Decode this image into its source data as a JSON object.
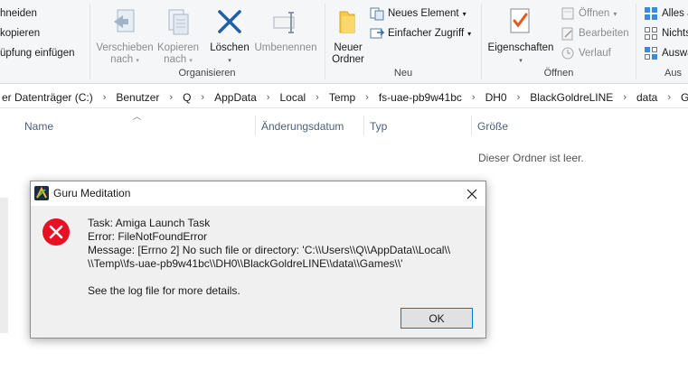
{
  "ribbon": {
    "clipboard": {
      "items": [
        "hneiden",
        "kopieren",
        "üpfung einfügen"
      ]
    },
    "organize": {
      "label": "Organisieren",
      "move_to": {
        "line1": "Verschieben",
        "line2": "nach"
      },
      "copy_to": {
        "line1": "Kopieren",
        "line2": "nach"
      },
      "delete": "Löschen",
      "rename": "Umbenennen"
    },
    "new": {
      "label": "Neu",
      "new_folder": {
        "line1": "Neuer",
        "line2": "Ordner"
      },
      "new_item": "Neues Element",
      "easy_access": "Einfacher Zugriff"
    },
    "open": {
      "label": "Öffnen",
      "properties": "Eigenschaften",
      "open": "Öffnen",
      "edit": "Bearbeiten",
      "history": "Verlauf"
    },
    "select": {
      "label": "Aus",
      "select_all": "Alles a",
      "select_none": "Nichts",
      "invert": "Auswa"
    }
  },
  "address": {
    "crumbs": [
      "er Datenträger (C:)",
      "Benutzer",
      "Q",
      "AppData",
      "Local",
      "Temp",
      "fs-uae-pb9w41bc",
      "DH0",
      "BlackGoldreLINE",
      "data",
      "Games"
    ]
  },
  "filelist": {
    "columns": [
      "Name",
      "Änderungsdatum",
      "Typ",
      "Größe"
    ],
    "empty_message": "Dieser Ordner ist leer."
  },
  "dialog": {
    "title": "Guru Meditation",
    "lines": [
      "Task: Amiga Launch Task",
      "Error: FileNotFoundError",
      "Message: [Errno 2] No such file or directory: 'C:\\\\Users\\\\Q\\\\AppData\\\\Local\\\\",
      "\\\\Temp\\\\fs-uae-pb9w41bc\\\\DH0\\\\BlackGoldreLINE\\\\data\\\\Games\\\\'",
      "",
      "See the log file for more details."
    ],
    "ok_label": "OK",
    "icon": "error-icon"
  },
  "colors": {
    "accent": "#0078d7",
    "error_red": "#e81123",
    "column_header": "#4c607a"
  }
}
